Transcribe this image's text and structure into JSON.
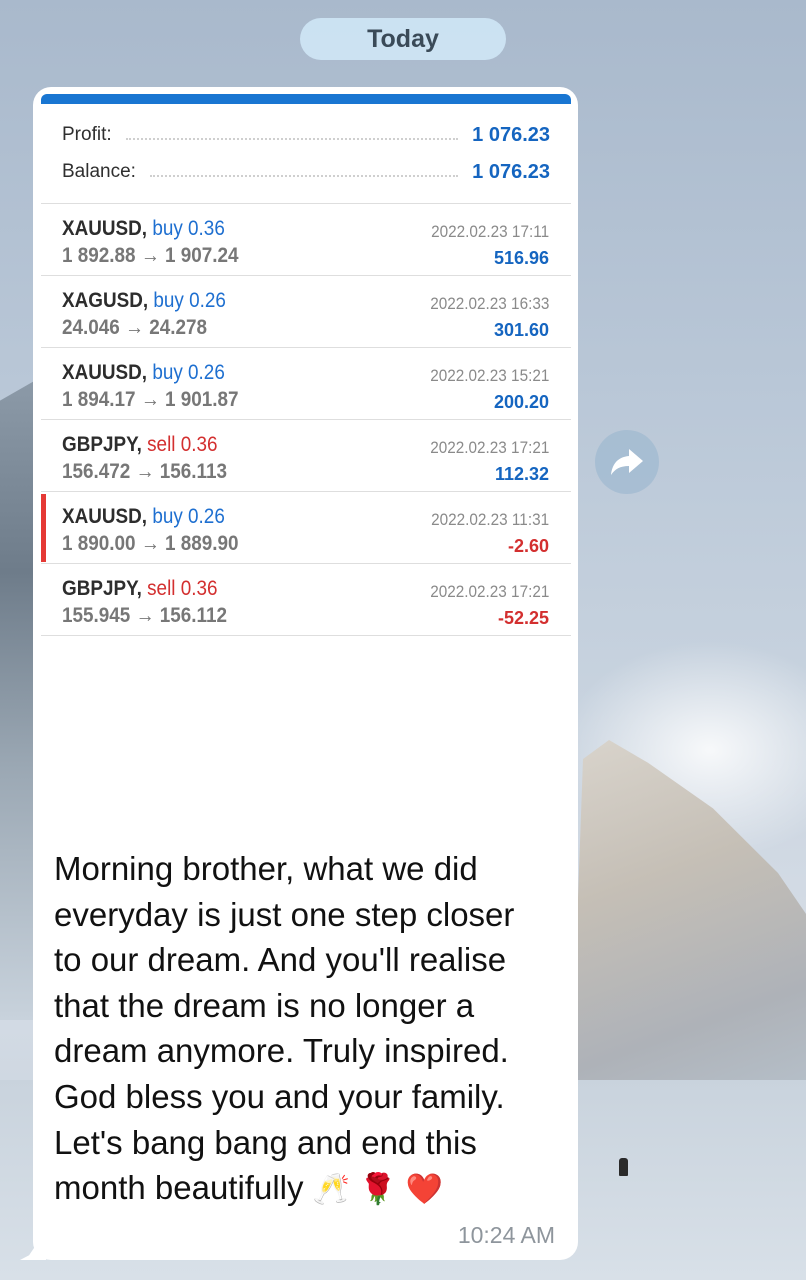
{
  "date_pill": "Today",
  "summary": {
    "profit_label": "Profit:",
    "profit_value": "1 076.23",
    "balance_label": "Balance:",
    "balance_value": "1 076.23"
  },
  "trades": [
    {
      "symbol": "XAUUSD,",
      "side": "buy 0.36",
      "prices": "1 892.88 → 1 907.24",
      "time": "2022.02.23 17:11",
      "pl": "516.96",
      "direction": "buy",
      "positive": true,
      "marked": false
    },
    {
      "symbol": "XAGUSD,",
      "side": "buy 0.26",
      "prices": "24.046 → 24.278",
      "time": "2022.02.23 16:33",
      "pl": "301.60",
      "direction": "buy",
      "positive": true,
      "marked": false
    },
    {
      "symbol": "XAUUSD,",
      "side": "buy 0.26",
      "prices": "1 894.17 → 1 901.87",
      "time": "2022.02.23 15:21",
      "pl": "200.20",
      "direction": "buy",
      "positive": true,
      "marked": false
    },
    {
      "symbol": "GBPJPY,",
      "side": "sell 0.36",
      "prices": "156.472 → 156.113",
      "time": "2022.02.23 17:21",
      "pl": "112.32",
      "direction": "sell",
      "positive": true,
      "marked": false
    },
    {
      "symbol": "XAUUSD,",
      "side": "buy 0.26",
      "prices": "1 890.00 → 1 889.90",
      "time": "2022.02.23 11:31",
      "pl": "-2.60",
      "direction": "buy",
      "positive": false,
      "marked": true
    },
    {
      "symbol": "GBPJPY,",
      "side": "sell 0.36",
      "prices": "155.945 → 156.112",
      "time": "2022.02.23 17:21",
      "pl": "-52.25",
      "direction": "sell",
      "positive": false,
      "marked": false
    }
  ],
  "message": {
    "lines": [
      "Morning brother, what we did",
      "everyday is just one step closer",
      "to our dream. And you'll realise",
      "that the dream is no longer a",
      "dream anymore. Truly inspired.",
      "God bless you and your family.",
      "Let's bang bang and end this",
      "month beautifully"
    ],
    "emojis": [
      "🥂",
      "🌹",
      "❤️"
    ],
    "time": "10:24 AM"
  },
  "icons": {
    "forward": "forward-arrow-icon"
  },
  "colors": {
    "accent_blue": "#1976d2",
    "profit_blue": "#1565c0",
    "loss_red": "#d32f2f"
  }
}
